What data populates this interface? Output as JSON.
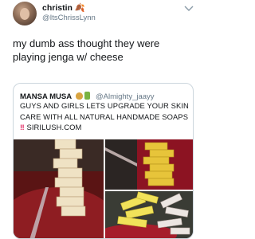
{
  "tweet": {
    "author_name": "christin",
    "author_emoji": "🍂",
    "author_handle": "@ItsChrissLynn",
    "text": "my dumb ass thought they were playing jenga w/ cheese"
  },
  "quoted_tweet": {
    "author_name": "MANSA MUSA",
    "author_handle": "@Almighty_jaayy",
    "text_before": "GUYS AND GIRLS LETS UPGRADE YOUR SKIN CARE WITH ALL NATURAL HANDMADE SOAPS",
    "text_after": "SIRILUSH.COM",
    "bang": "‼",
    "icons": [
      "moneybag-icon",
      "bottle-icon"
    ]
  },
  "photos": [
    {
      "name": "photo-soap-tower"
    },
    {
      "name": "photo-yellow-soap-stack"
    },
    {
      "name": "photo-soap-blocks-pile"
    }
  ],
  "colors": {
    "text": "#14171a",
    "secondary": "#657786",
    "border": "#ccd6dd",
    "alert": "#e0245e"
  }
}
